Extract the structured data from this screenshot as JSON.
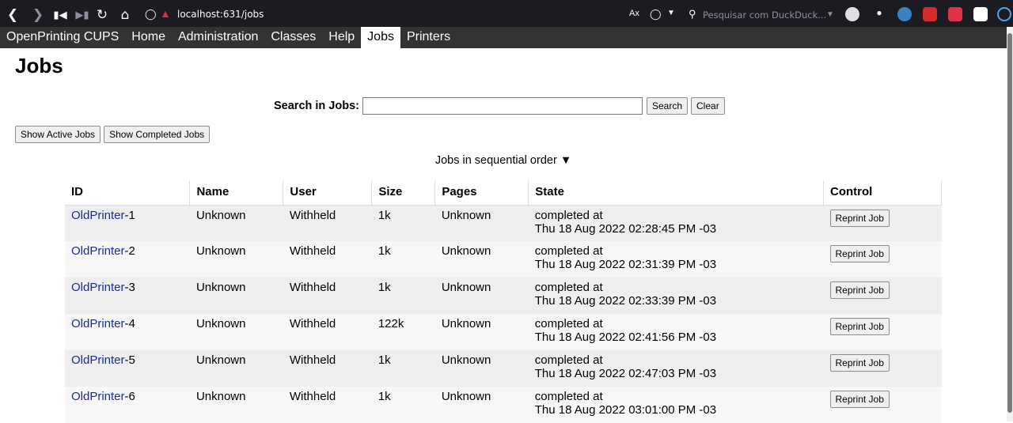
{
  "browser": {
    "url": "localhost:631/jobs",
    "search_placeholder": "Pesquisar com DuckDuck..."
  },
  "nav": {
    "items": [
      "OpenPrinting CUPS",
      "Home",
      "Administration",
      "Classes",
      "Help",
      "Jobs",
      "Printers"
    ],
    "active": "Jobs"
  },
  "page": {
    "title": "Jobs",
    "search_label": "Search in Jobs:",
    "search_value": "",
    "search_button": "Search",
    "clear_button": "Clear",
    "show_active": "Show Active Jobs",
    "show_completed": "Show Completed Jobs",
    "sort_text": "Jobs in sequential order ▼"
  },
  "table": {
    "headers": [
      "ID",
      "Name",
      "User",
      "Size",
      "Pages",
      "State",
      "Control"
    ],
    "rows": [
      {
        "printer": "OldPrinter",
        "num": "-1",
        "name": "Unknown",
        "user": "Withheld",
        "size": "1k",
        "pages": "Unknown",
        "state1": "completed at",
        "state2": "Thu 18 Aug 2022 02:28:45 PM -03",
        "control": "Reprint Job"
      },
      {
        "printer": "OldPrinter",
        "num": "-2",
        "name": "Unknown",
        "user": "Withheld",
        "size": "1k",
        "pages": "Unknown",
        "state1": "completed at",
        "state2": "Thu 18 Aug 2022 02:31:39 PM -03",
        "control": "Reprint Job"
      },
      {
        "printer": "OldPrinter",
        "num": "-3",
        "name": "Unknown",
        "user": "Withheld",
        "size": "1k",
        "pages": "Unknown",
        "state1": "completed at",
        "state2": "Thu 18 Aug 2022 02:33:39 PM -03",
        "control": "Reprint Job"
      },
      {
        "printer": "OldPrinter",
        "num": "-4",
        "name": "Unknown",
        "user": "Withheld",
        "size": "122k",
        "pages": "Unknown",
        "state1": "completed at",
        "state2": "Thu 18 Aug 2022 02:41:56 PM -03",
        "control": "Reprint Job"
      },
      {
        "printer": "OldPrinter",
        "num": "-5",
        "name": "Unknown",
        "user": "Withheld",
        "size": "1k",
        "pages": "Unknown",
        "state1": "completed at",
        "state2": "Thu 18 Aug 2022 02:47:03 PM -03",
        "control": "Reprint Job"
      },
      {
        "printer": "OldPrinter",
        "num": "-6",
        "name": "Unknown",
        "user": "Withheld",
        "size": "1k",
        "pages": "Unknown",
        "state1": "completed at",
        "state2": "Thu 18 Aug 2022 03:01:00 PM -03",
        "control": "Reprint Job"
      }
    ]
  },
  "colors": {
    "nav_bg": "#333333",
    "link": "#1a2a99",
    "row_odd": "#eeeeee",
    "row_even": "#f7f7f7"
  }
}
